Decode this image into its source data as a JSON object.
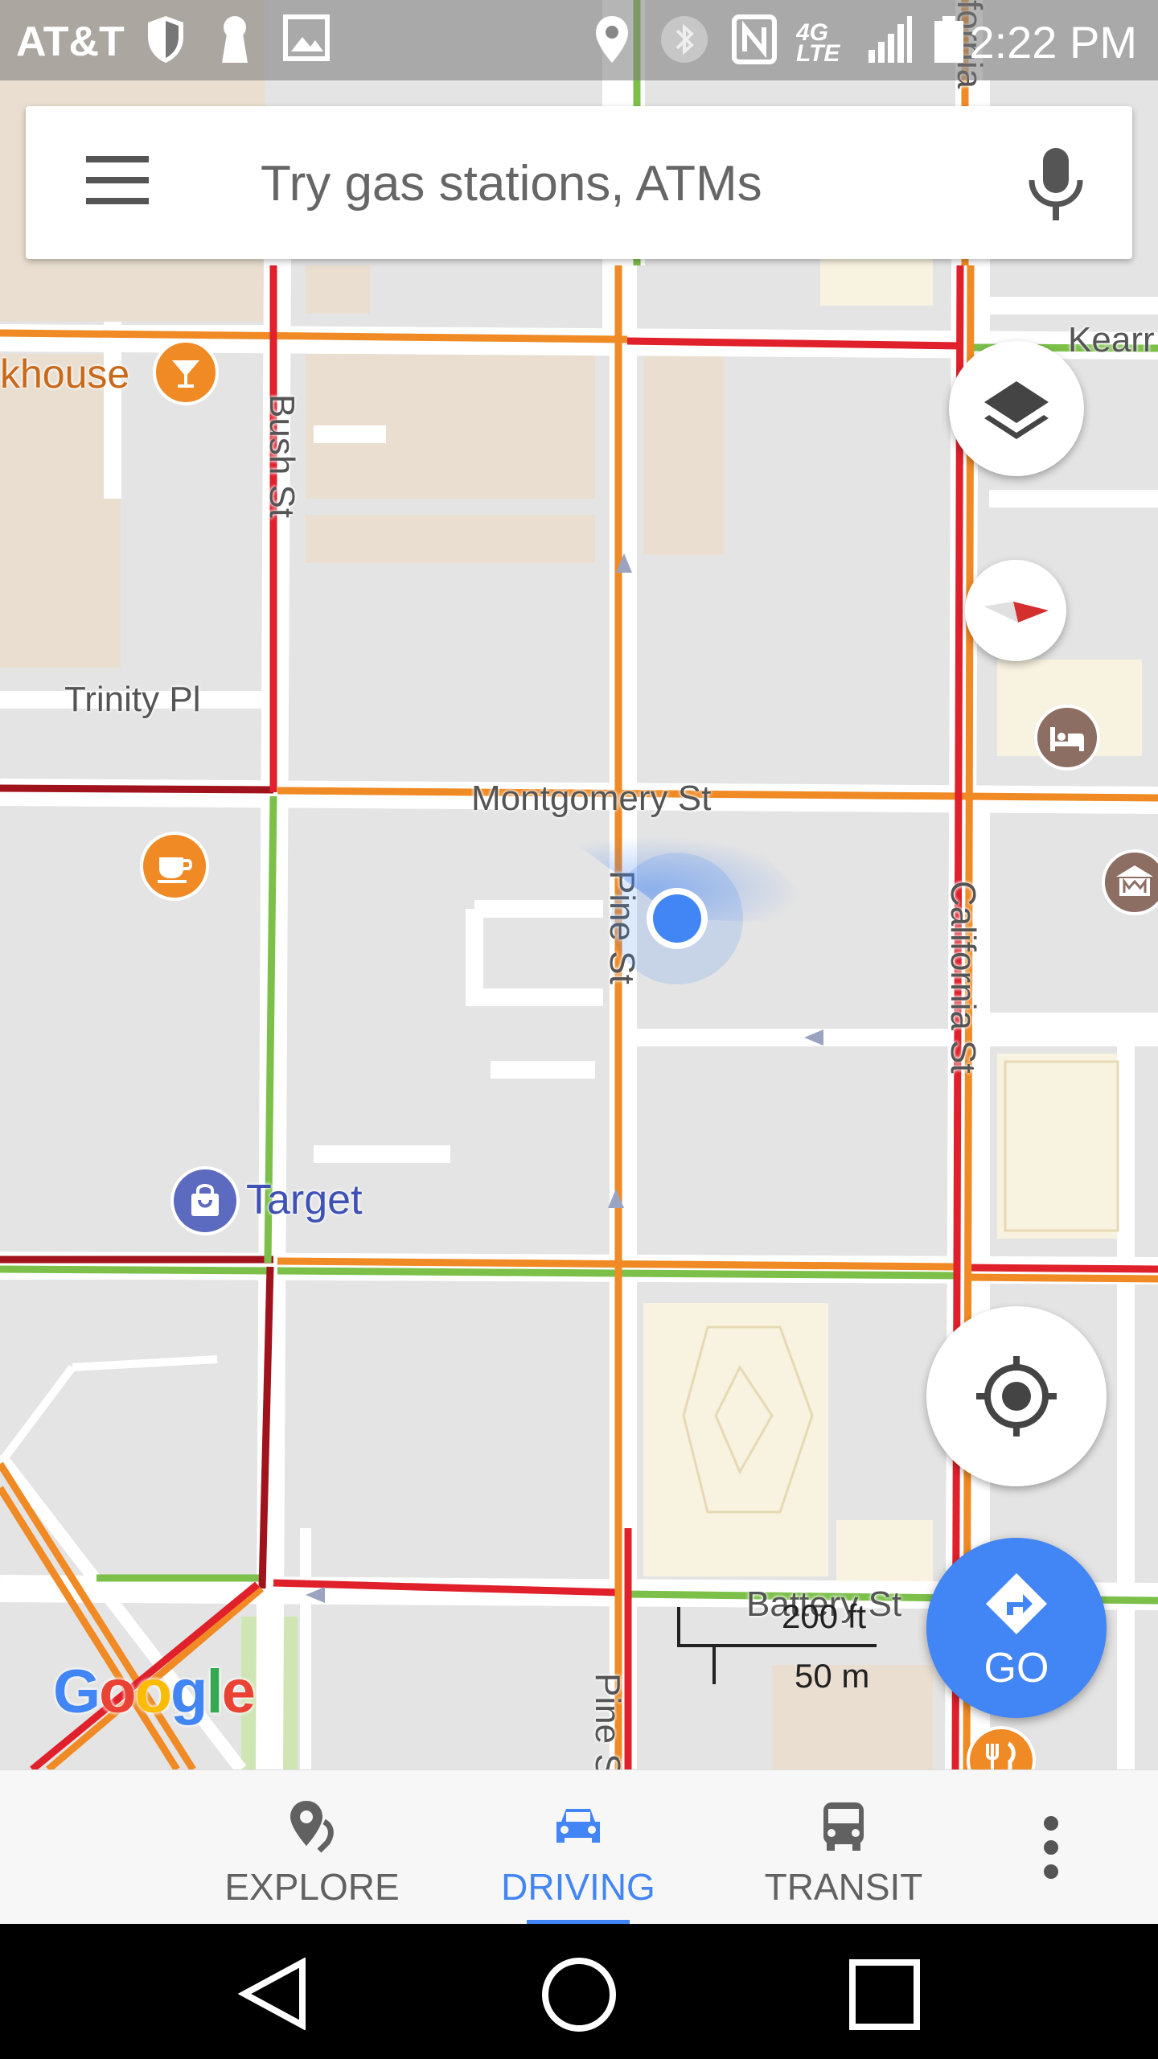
{
  "status_bar": {
    "carrier": "AT&T",
    "time": "2:22 PM",
    "network": "4G LTE",
    "icons": [
      "shield-icon",
      "keyhole-icon",
      "image-icon",
      "location-icon",
      "bluetooth-icon",
      "nfc-icon",
      "signal-icon",
      "battery-icon"
    ]
  },
  "search": {
    "placeholder": "Try gas stations, ATMs",
    "menu_icon": "hamburger-menu-icon",
    "mic_icon": "microphone-icon"
  },
  "map": {
    "streets": [
      {
        "id": "bush",
        "name": "Bush St"
      },
      {
        "id": "trinity",
        "name": "Trinity Pl"
      },
      {
        "id": "montgomery",
        "name": "Montgomery St"
      },
      {
        "id": "pine",
        "name": "Pine St"
      },
      {
        "id": "pine_partial",
        "name": "Pine S"
      },
      {
        "id": "california",
        "name": "California St"
      },
      {
        "id": "battery",
        "name": "Battery St"
      },
      {
        "id": "kearny",
        "name": "Kearr"
      },
      {
        "id": "california_top",
        "name": "fornia"
      }
    ],
    "places": [
      {
        "id": "khouse",
        "name": "khouse",
        "icon": "cocktail-icon"
      },
      {
        "id": "target",
        "name": "Target",
        "icon": "shopping-bag-icon"
      }
    ],
    "poi_icons": [
      "coffee-cup-icon",
      "hotel-bed-icon",
      "museum-icon",
      "restaurant-icon"
    ],
    "scale": {
      "imperial": "200 ft",
      "metric": "50 m"
    },
    "logo": "Google"
  },
  "controls": {
    "layers_icon": "layers-icon",
    "compass_icon": "compass-icon",
    "location_icon": "my-location-icon",
    "go_label": "GO",
    "go_icon": "directions-icon"
  },
  "bottom_nav": {
    "tabs": [
      {
        "label": "EXPLORE",
        "icon": "explore-pin-icon",
        "active": false
      },
      {
        "label": "DRIVING",
        "icon": "car-icon",
        "active": true
      },
      {
        "label": "TRANSIT",
        "icon": "bus-icon",
        "active": false
      }
    ],
    "more_icon": "more-vert-icon"
  },
  "colors": {
    "accent": "#4285f4",
    "traffic_orange": "#f08a24",
    "traffic_red": "#e0202a",
    "traffic_dark_red": "#a0131c",
    "traffic_green": "#7cc04a",
    "poi_orange": "#f08a24",
    "poi_brown": "#8d6e63",
    "target_purple": "#5c6bc0"
  }
}
